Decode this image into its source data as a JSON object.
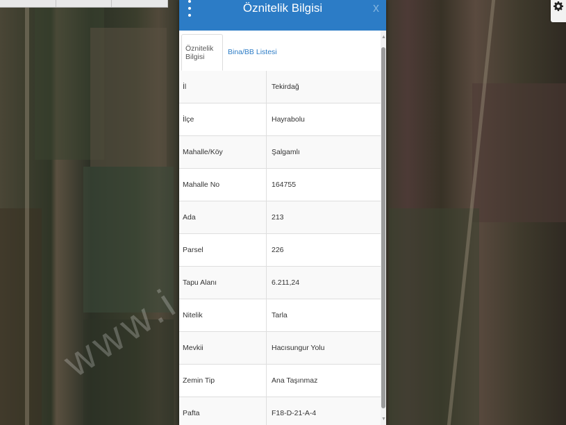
{
  "watermark": "www.i      .com.tr",
  "panel": {
    "title": "Öznitelik Bilgisi",
    "close_label": "x"
  },
  "tabs": [
    {
      "label": "Öznitelik Bilgisi",
      "active": true
    },
    {
      "label": "Bina/BB Listesi",
      "active": false
    }
  ],
  "attributes": [
    {
      "key": "İl",
      "value": "Tekirdağ"
    },
    {
      "key": "İlçe",
      "value": "Hayrabolu"
    },
    {
      "key": "Mahalle/Köy",
      "value": "Şalgamlı"
    },
    {
      "key": "Mahalle No",
      "value": "164755"
    },
    {
      "key": "Ada",
      "value": "213"
    },
    {
      "key": "Parsel",
      "value": "226"
    },
    {
      "key": "Tapu Alanı",
      "value": "6.211,24"
    },
    {
      "key": "Nitelik",
      "value": "Tarla"
    },
    {
      "key": "Mevkii",
      "value": "Hacısungur Yolu"
    },
    {
      "key": "Zemin Tip",
      "value": "Ana Taşınmaz"
    },
    {
      "key": "Pafta",
      "value": "F18-D-21-A-4"
    }
  ],
  "icons": {
    "menu": "vertical-dots-icon",
    "settings": "gear-icon",
    "scroll_up": "triangle-up-icon",
    "scroll_down": "triangle-down-icon"
  }
}
